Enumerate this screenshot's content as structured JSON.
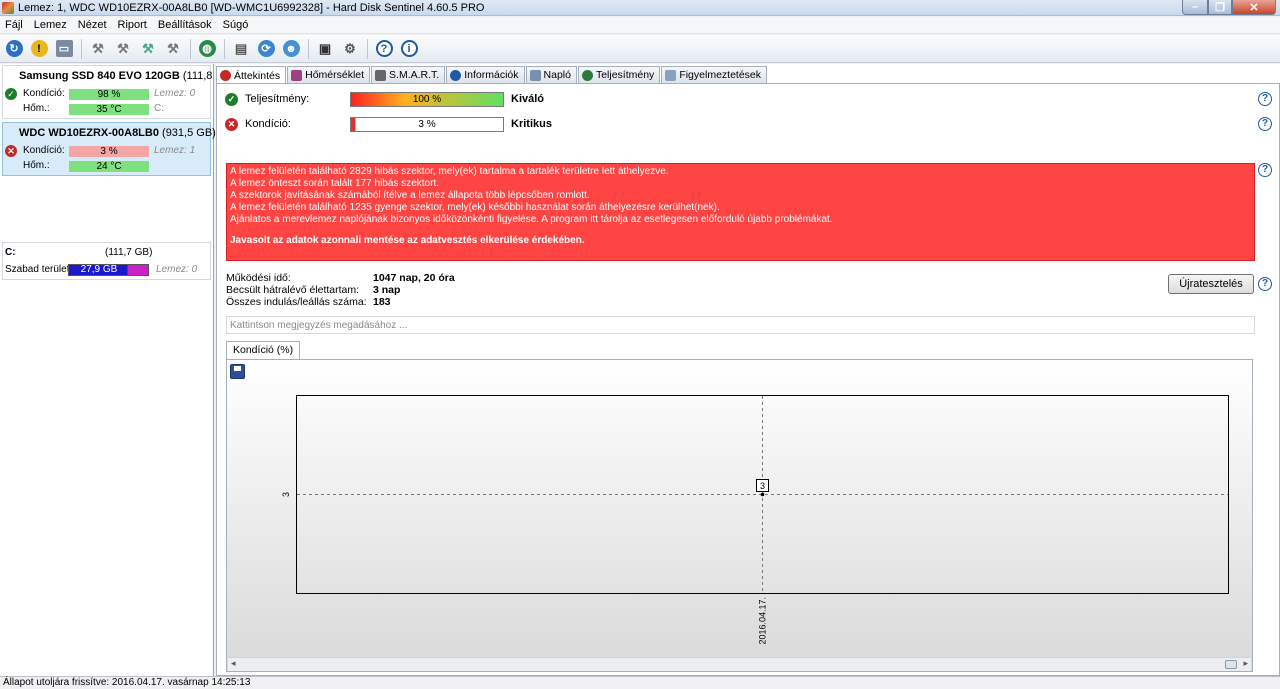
{
  "window": {
    "title": "Lemez: 1, WDC WD10EZRX-00A8LB0 [WD-WMC1U6992328]  -  Hard Disk Sentinel 4.60.5 PRO"
  },
  "menu": [
    "Fájl",
    "Lemez",
    "Nézet",
    "Riport",
    "Beállítások",
    "Súgó"
  ],
  "toolbar": {
    "icons": [
      "refresh-icon",
      "warning-icon",
      "disk-icon",
      "test-icon",
      "test-icon",
      "test-icon",
      "test-icon",
      "globe-icon",
      "report-icon",
      "sync-icon",
      "user-icon",
      "config-icon",
      "settings-icon",
      "help-icon",
      "info-icon"
    ]
  },
  "disks": [
    {
      "name": "Samsung SSD 840 EVO 120GB",
      "size": "(111,8 GB)",
      "health_label": "Kondíció:",
      "health_value": "98 %",
      "health_extra": "Lemez: 0",
      "temp_label": "Hőm.:",
      "temp_value": "35 °C",
      "temp_extra": "C:",
      "status_color": "#1e7d2c"
    },
    {
      "name": "WDC WD10EZRX-00A8LB0",
      "size": "(931,5 GB)",
      "health_label": "Kondíció:",
      "health_value": "3 %",
      "health_extra": "Lemez: 1",
      "temp_label": "Hőm.:",
      "temp_value": "24 °C",
      "status_color": "#c62828"
    }
  ],
  "volume": {
    "name": "C:",
    "size": "(111,7 GB)",
    "free_label": "Szabad terület",
    "free_value": "27,9 GB",
    "extra": "Lemez: 0"
  },
  "tabs": [
    "Áttekintés",
    "Hőmérséklet",
    "S.M.A.R.T.",
    "Információk",
    "Napló",
    "Teljesítmény",
    "Figyelmeztetések"
  ],
  "overview": {
    "performance_label": "Teljesítmény:",
    "performance_value": "100 %",
    "performance_text": "Kiváló",
    "health_label": "Kondíció:",
    "health_value": "3 %",
    "health_text": "Kritikus",
    "alert_lines": [
      "A lemez felületén található 2829 hibás szektor, mely(ek) tartalma a tartalék területre lett áthelyezve.",
      "A lemez önteszt során talált 177 hibás szektort.",
      "A szektorok javításának számából ítélve a lemez állapota több lépcsőben romlott.",
      "A lemez felületén található 1235 gyenge szektor, mely(ek) későbbi használat során áthelyezésre kerülhet(nek).",
      "Ajánlatos a merevlemez naplójának bizonyos időközönkénti figyelése. A program itt tárolja az esetlegesen előforduló újabb problémákat."
    ],
    "alert_strong": "Javasolt az adatok azonnali mentése az adatvesztés elkerülése érdekében.",
    "uptime_label": "Működési idő:",
    "uptime_value": "1047 nap, 20 óra",
    "remaining_label": "Becsült hátralévő élettartam:",
    "remaining_value": "3 nap",
    "startstop_label": "Összes indulás/leállás száma:",
    "startstop_value": "183",
    "retest_label": "Újratesztelés",
    "note_placeholder": "Kattintson megjegyzés megadásához ...",
    "graph_tab": "Kondíció  (%)"
  },
  "chart_data": {
    "type": "line",
    "x": [
      "2016.04.17."
    ],
    "series": [
      {
        "values": [
          3
        ]
      }
    ],
    "ytick": "3",
    "point_label": "3",
    "grid": true
  },
  "statusbar": {
    "text": "Állapot utoljára frissítve: 2016.04.17. vasárnap 14:25:13"
  },
  "colors": {
    "alert_bg": "#ff4444",
    "good": "#1e7d2c",
    "bad": "#c62828"
  }
}
